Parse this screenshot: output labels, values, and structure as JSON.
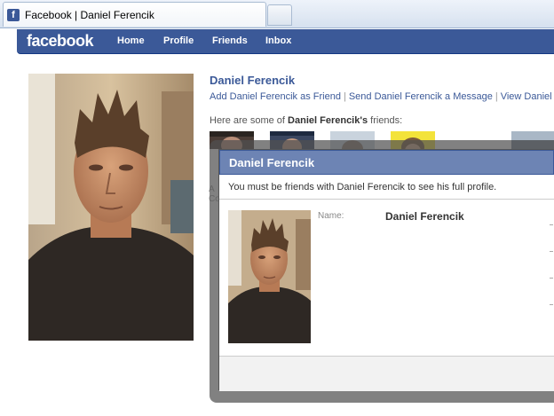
{
  "browser": {
    "tab_title": "Facebook | Daniel Ferencik",
    "favicon_letter": "f"
  },
  "nav": {
    "logo": "facebook",
    "items": [
      "Home",
      "Profile",
      "Friends",
      "Inbox"
    ]
  },
  "profile": {
    "name": "Daniel Ferencik",
    "action_add": "Add Daniel Ferencik as Friend",
    "action_message": "Send Daniel Ferencik a Message",
    "action_view": "View Daniel Fere",
    "separator": "|",
    "friends_prefix": "Here are some of ",
    "friends_name": "Daniel Ferencik's",
    "friends_suffix": " friends:",
    "left_cut_1": "A",
    "left_cut_2": "Co"
  },
  "modal": {
    "title": "Daniel Ferencik",
    "message": "You must be friends with Daniel Ferencik to see his full profile.",
    "name_label": "Name:",
    "name_value": "Daniel Ferencik"
  }
}
